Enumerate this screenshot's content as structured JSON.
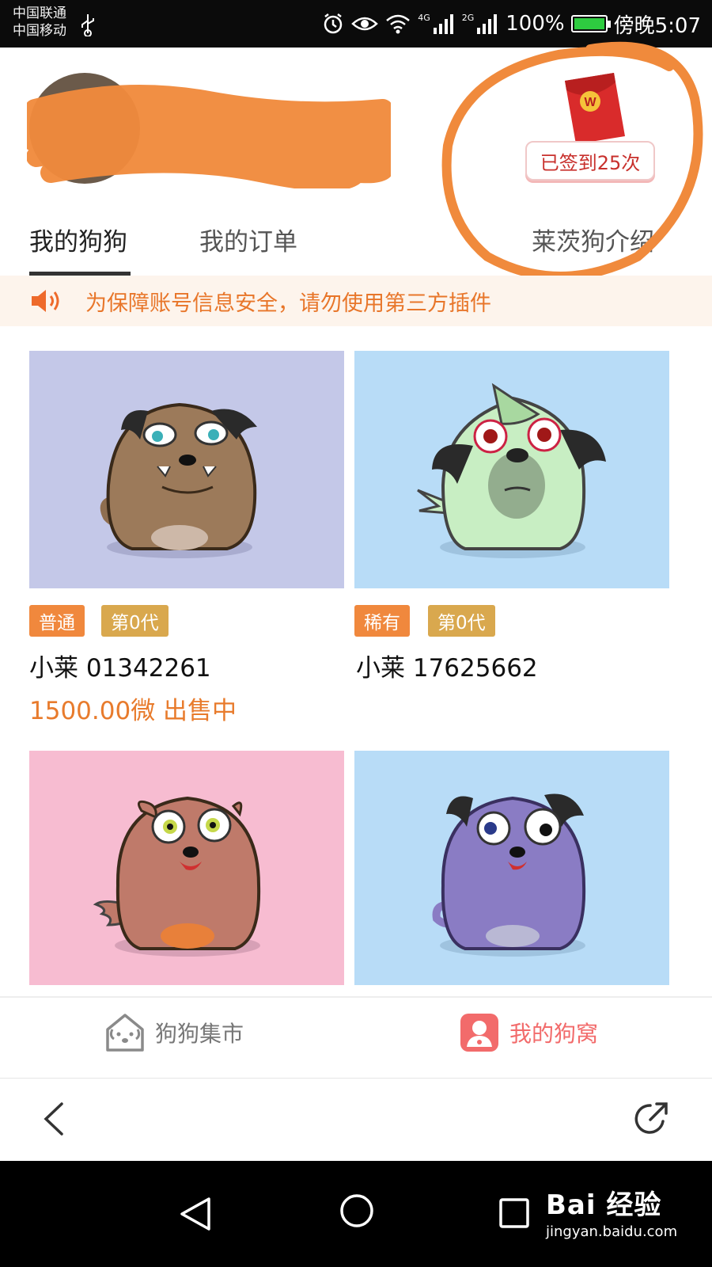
{
  "status_bar": {
    "carrier_1": "中国联通",
    "carrier_2": "中国移动",
    "net_4g": "4G",
    "net_2g": "2G",
    "battery": "100%",
    "time": "傍晚5:07"
  },
  "header": {
    "signin_label": "已签到25次",
    "redpacket_symbol": "W"
  },
  "tabs": [
    {
      "label": "我的狗狗",
      "active": true
    },
    {
      "label": "我的订单",
      "active": false
    },
    {
      "label": "莱茨狗介绍",
      "active": false
    }
  ],
  "notice": {
    "text": "为保障账号信息安全，请勿使用第三方插件"
  },
  "dogs": [
    {
      "tag_rarity": "普通",
      "tag_generation": "第0代",
      "name": "小莱 01342261",
      "status": "1500.00微 出售中",
      "bg": "#c4c8e8"
    },
    {
      "tag_rarity": "稀有",
      "tag_generation": "第0代",
      "name": "小莱 17625662",
      "status": "",
      "bg": "#b8dcf7"
    },
    {
      "bg": "#f7bcd1"
    },
    {
      "bg": "#b8dcf7"
    }
  ],
  "bottom_nav": {
    "market_label": "狗狗集市",
    "mine_label": "我的狗窝"
  },
  "watermark": {
    "main": "Bai  经验",
    "sub": "jingyan.baidu.com"
  },
  "colors": {
    "accent_orange": "#f0883d",
    "gold": "#d9a84e",
    "price": "#e87b2c",
    "active_nav": "#f26b6b"
  }
}
